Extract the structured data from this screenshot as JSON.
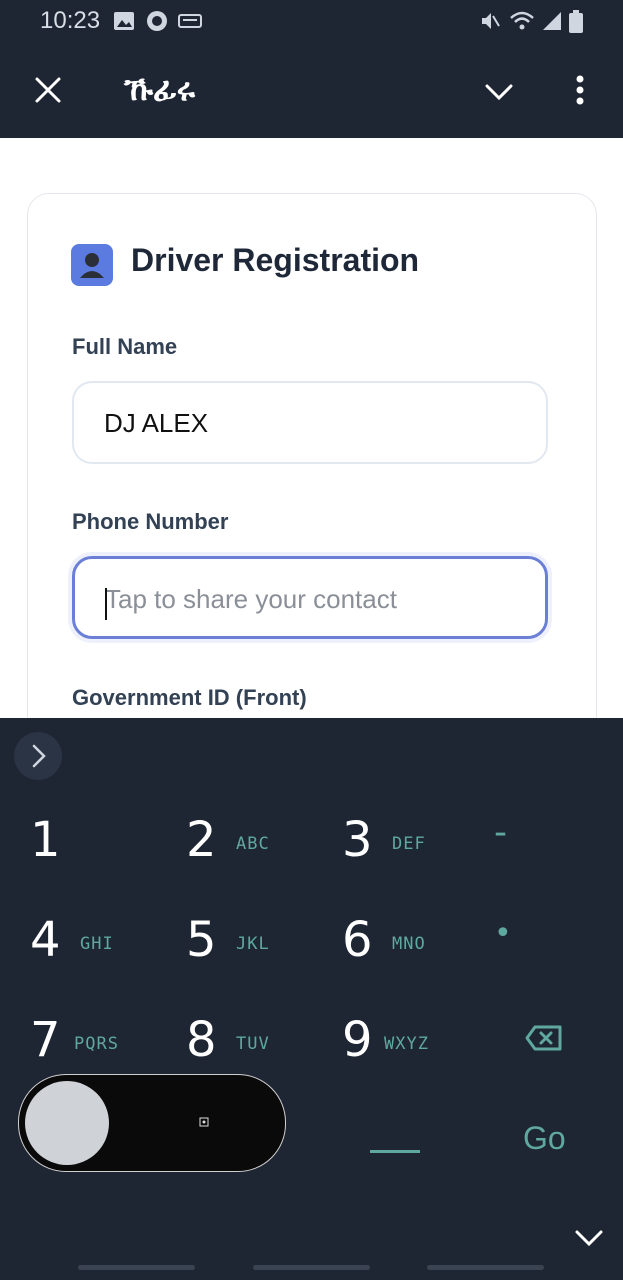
{
  "status_bar": {
    "time": "10:23",
    "icons": [
      "image-icon",
      "whatsapp-icon",
      "keyboard-icon",
      "mute-icon",
      "wifi-icon",
      "signal-icon",
      "battery-icon"
    ]
  },
  "app_bar": {
    "title": "ኹፊሩ",
    "close_icon": "close-icon",
    "dropdown_icon": "chevron-down-icon",
    "menu_icon": "more-vertical-icon"
  },
  "card": {
    "icon": "driver-icon",
    "title": "Driver Registration",
    "fields": [
      {
        "label": "Full Name",
        "value": "DJ ALEX",
        "placeholder": ""
      },
      {
        "label": "Phone Number",
        "value": "",
        "placeholder": "Tap to share your contact"
      },
      {
        "label": "Government ID (Front)"
      }
    ]
  },
  "keyboard": {
    "keys": [
      {
        "num": "1",
        "letters": ""
      },
      {
        "num": "2",
        "letters": "ABC"
      },
      {
        "num": "3",
        "letters": "DEF"
      },
      {
        "num": "-",
        "letters": ""
      },
      {
        "num": "4",
        "letters": "GHI"
      },
      {
        "num": "5",
        "letters": "JKL"
      },
      {
        "num": "6",
        "letters": "MNO"
      },
      {
        "num": "•",
        "letters": ""
      },
      {
        "num": "7",
        "letters": "PQRS"
      },
      {
        "num": "8",
        "letters": "TUV"
      },
      {
        "num": "9",
        "letters": "WXYZ"
      }
    ],
    "go_label": "Go",
    "backspace_icon": "backspace-icon",
    "space_icon": "space-icon",
    "collapse_icon": "chevron-right-icon",
    "hide_icon": "chevron-down-icon"
  },
  "colors": {
    "app_bar_bg": "#1f2633",
    "accent": "#6b7fd7",
    "keyboard_letters": "#5fa89f"
  }
}
